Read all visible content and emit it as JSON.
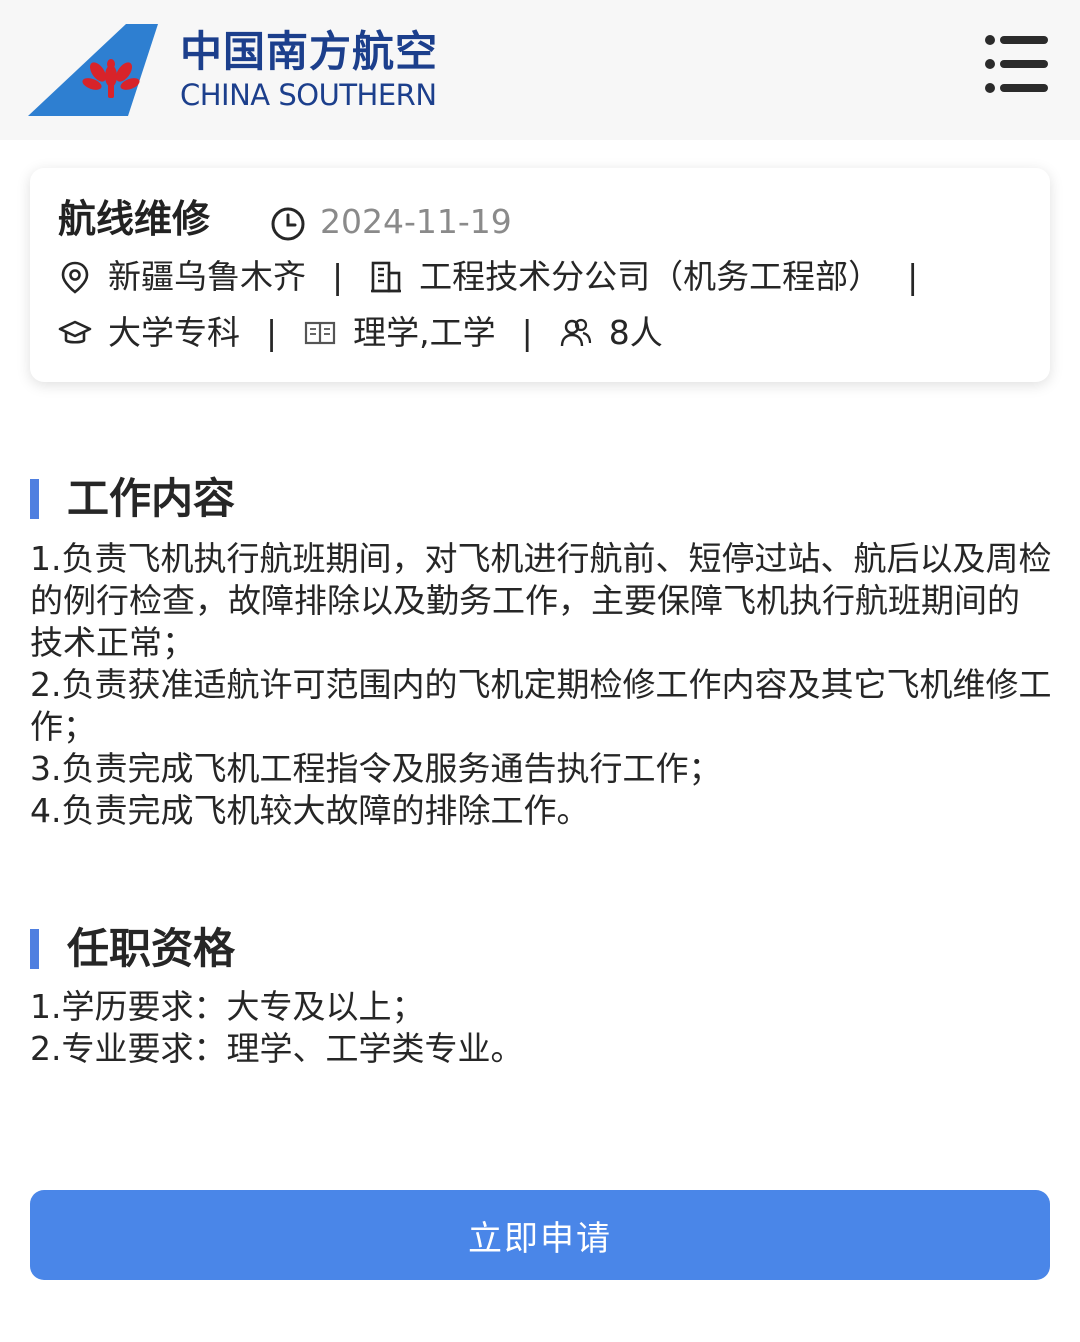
{
  "header": {
    "brand_cn": "中国南方航空",
    "brand_en": "CHINA SOUTHERN",
    "logo_icon": "china-southern-kapok-logo",
    "menu_icon": "hamburger-menu-icon",
    "brand_color": "#1c3f8c",
    "logo_blue": "#2e7fd1",
    "logo_red": "#d8232a"
  },
  "job": {
    "title": "航线维修",
    "date": "2024-11-19",
    "location": "新疆乌鲁木齐",
    "department": "工程技术分公司（机务工程部）",
    "education": "大学专科",
    "majors": "理学,工学",
    "headcount": "8人",
    "separator": "|"
  },
  "sections": [
    {
      "title": "工作内容",
      "lines": [
        "1.负责飞机执行航班期间，对飞机进行航前、短停过站、航后以及周检的例行检查，故障排除以及勤务工作，主要保障飞机执行航班期间的技术正常；",
        "2.负责获准适航许可范围内的飞机定期检修工作内容及其它飞机维修工作；",
        "3.负责完成飞机工程指令及服务通告执行工作；",
        "4.负责完成飞机较大故障的排除工作。"
      ]
    },
    {
      "title": "任职资格",
      "lines": [
        "1.学历要求：大专及以上；",
        "2.专业要求：理学、工学类专业。"
      ]
    }
  ],
  "apply_label": "立即申请",
  "colors": {
    "accent": "#4f7fe0",
    "button": "#4a86e8",
    "date_gray": "#8a8a8a"
  }
}
